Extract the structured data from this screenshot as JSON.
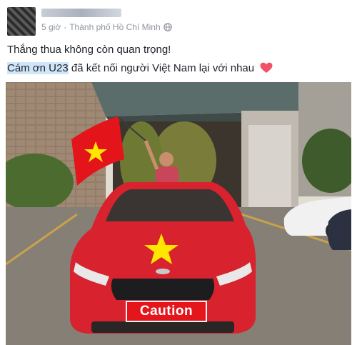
{
  "post": {
    "timestamp": "5 giờ",
    "separator": "·",
    "location": "Thành phố Hồ Chí Minh",
    "privacy_icon": "globe-icon",
    "line1": "Thắng thua không còn quan trọng!",
    "line2_highlight": "Cám ơn U23",
    "line2_rest": " đã kết nối người Việt Nam lại với nhau",
    "emoji": "heart-icon",
    "photo": {
      "sign_text": "Caution",
      "colors": {
        "flag_red": "#e4141b",
        "flag_star": "#ffe600",
        "car_red": "#d8222e"
      }
    }
  }
}
